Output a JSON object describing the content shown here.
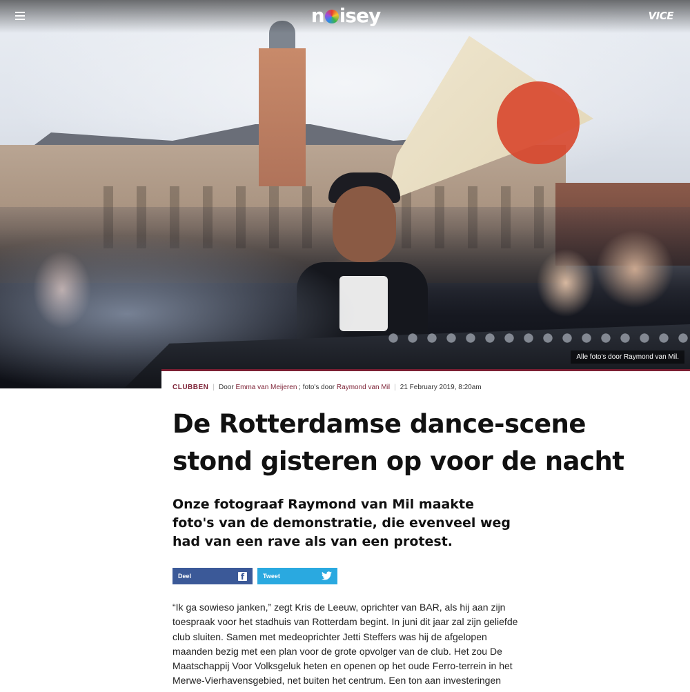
{
  "header": {
    "logo_text": "noisey",
    "vice_label": "VICE",
    "menu_icon": "hamburger-menu-icon"
  },
  "hero": {
    "caption": "Alle foto's door Raymond van Mil."
  },
  "article": {
    "meta": {
      "category": "CLUBBEN",
      "by_label": "Door",
      "author": "Emma van Meijeren",
      "photo_label": "; foto's door",
      "photographer": "Raymond van Mil",
      "date": "21 February 2019, 8:20am"
    },
    "title": "De Rotterdamse dance-scene stond gisteren op voor de nacht",
    "dek": "Onze fotograaf Raymond van Mil maakte foto's van de demonstratie, die evenveel weg had van een rave als van een protest.",
    "share": {
      "facebook_label": "Deel",
      "twitter_label": "Tweet"
    },
    "body": "“Ik ga sowieso janken,” zegt Kris de Leeuw, oprichter van BAR, als hij aan zijn toespraak voor het stadhuis van Rotterdam begint. In juni dit jaar zal zijn geliefde club sluiten. Samen met medeoprichter Jetti Steffers was hij de afgelopen maanden bezig met een plan voor de grote opvolger van de club. Het zou De Maatschappij Voor Volksgeluk heten en openen op het oude Ferro-terrein in het Merwe-Vierhavensgebied, net buiten het centrum. Een ton aan investeringen"
  },
  "colors": {
    "accent": "#7b1f33",
    "facebook": "#3b5998",
    "twitter": "#2aa9e0"
  }
}
